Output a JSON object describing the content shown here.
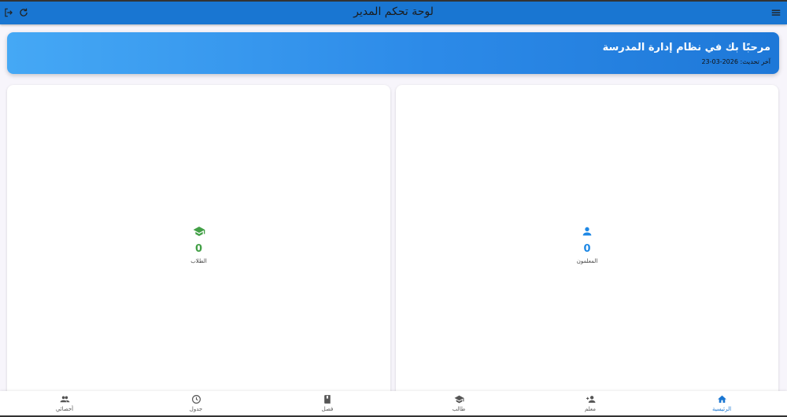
{
  "app": {
    "title": "لوحة تحكم المدير"
  },
  "banner": {
    "welcome": "مرحبًا بك في نظام إدارة المدرسة",
    "last_updated": "آخر تحديث: 2026-03-23"
  },
  "stats": {
    "students": {
      "value": "0",
      "label": "الطلاب",
      "color": "#43a047"
    },
    "teachers": {
      "value": "0",
      "label": "المعلمون",
      "color": "#1e88e5"
    }
  },
  "bottom_nav": {
    "items": [
      {
        "label": "الرئيسية",
        "icon": "home-icon"
      },
      {
        "label": "معلم",
        "icon": "person-add-icon"
      },
      {
        "label": "طالب",
        "icon": "school-icon"
      },
      {
        "label": "فصل",
        "icon": "book-icon"
      },
      {
        "label": "جدول",
        "icon": "clock-icon"
      },
      {
        "label": "أخصائي",
        "icon": "people-icon"
      }
    ],
    "active_color": "#1976d2"
  }
}
